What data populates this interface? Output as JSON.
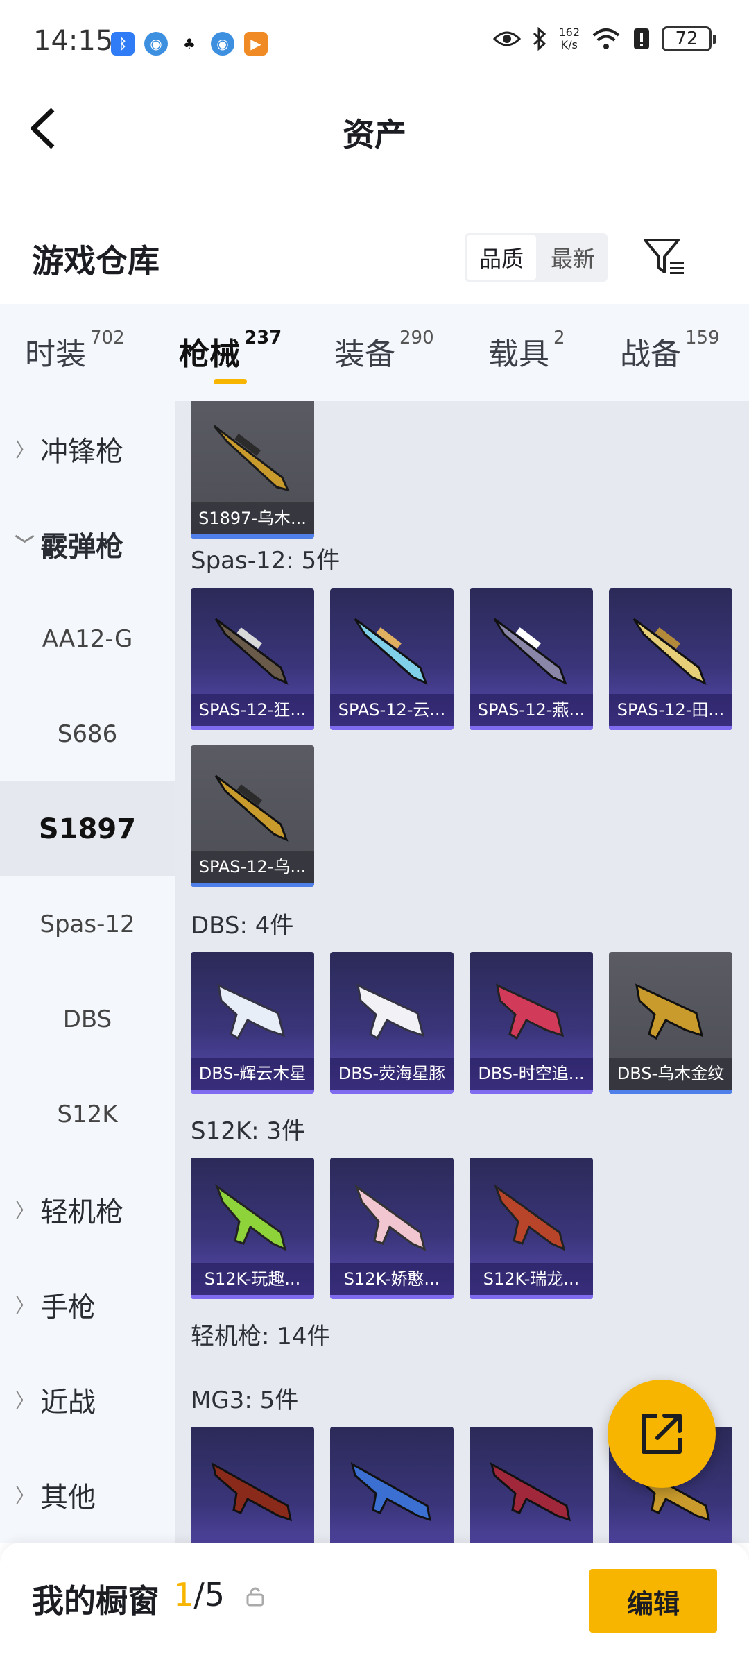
{
  "status_bar": {
    "time": "14:15",
    "net_speed_top": "162",
    "net_speed_bottom": "K/s",
    "battery": "72",
    "app_icons": [
      "bluetooth-app-icon",
      "browser-icon",
      "qq-icon",
      "browser-icon",
      "video-app-icon"
    ]
  },
  "header": {
    "title": "资产"
  },
  "section": {
    "title": "游戏仓库",
    "sort_options": [
      "品质",
      "最新"
    ],
    "sort_selected": "品质"
  },
  "tabs": [
    {
      "label": "时装",
      "count": "702"
    },
    {
      "label": "枪械",
      "count": "237",
      "active": true
    },
    {
      "label": "装备",
      "count": "290"
    },
    {
      "label": "载具",
      "count": "2"
    },
    {
      "label": "战备",
      "count": "159"
    }
  ],
  "left_nav": {
    "items": [
      {
        "label": "冲锋枪",
        "type": "group",
        "expanded": false
      },
      {
        "label": "霰弹枪",
        "type": "group",
        "expanded": true
      },
      {
        "label": "AA12-G",
        "type": "sub"
      },
      {
        "label": "S686",
        "type": "sub"
      },
      {
        "label": "S1897",
        "type": "sub",
        "selected": true
      },
      {
        "label": "Spas-12",
        "type": "sub"
      },
      {
        "label": "DBS",
        "type": "sub"
      },
      {
        "label": "S12K",
        "type": "sub"
      },
      {
        "label": "轻机枪",
        "type": "group",
        "expanded": false
      },
      {
        "label": "手枪",
        "type": "group",
        "expanded": false
      },
      {
        "label": "近战",
        "type": "group",
        "expanded": false
      },
      {
        "label": "其他",
        "type": "group",
        "expanded": false
      }
    ]
  },
  "content": {
    "groups": [
      {
        "label": "",
        "items": [
          "S1897-乌木..."
        ]
      },
      {
        "label": "Spas-12: 5件",
        "items": [
          "SPAS-12-狂...",
          "SPAS-12-云...",
          "SPAS-12-燕...",
          "SPAS-12-田...",
          "SPAS-12-乌..."
        ]
      },
      {
        "label": "DBS: 4件",
        "items": [
          "DBS-辉云木星",
          "DBS-荧海星豚",
          "DBS-时空追...",
          "DBS-乌木金纹"
        ]
      },
      {
        "label": "S12K: 3件",
        "items": [
          "S12K-玩趣...",
          "S12K-娇憨...",
          "S12K-瑞龙..."
        ]
      },
      {
        "label": "轻机枪: 14件",
        "items": []
      },
      {
        "label": "MG3: 5件",
        "items": [
          "",
          "",
          "",
          ""
        ]
      }
    ]
  },
  "bottom_bar": {
    "title": "我的橱窗",
    "current": "1",
    "total": "/5",
    "edit_label": "编辑"
  },
  "colors": {
    "accent": "#f7b500",
    "card_purple": "#3a357a",
    "card_gray": "#55565e"
  }
}
